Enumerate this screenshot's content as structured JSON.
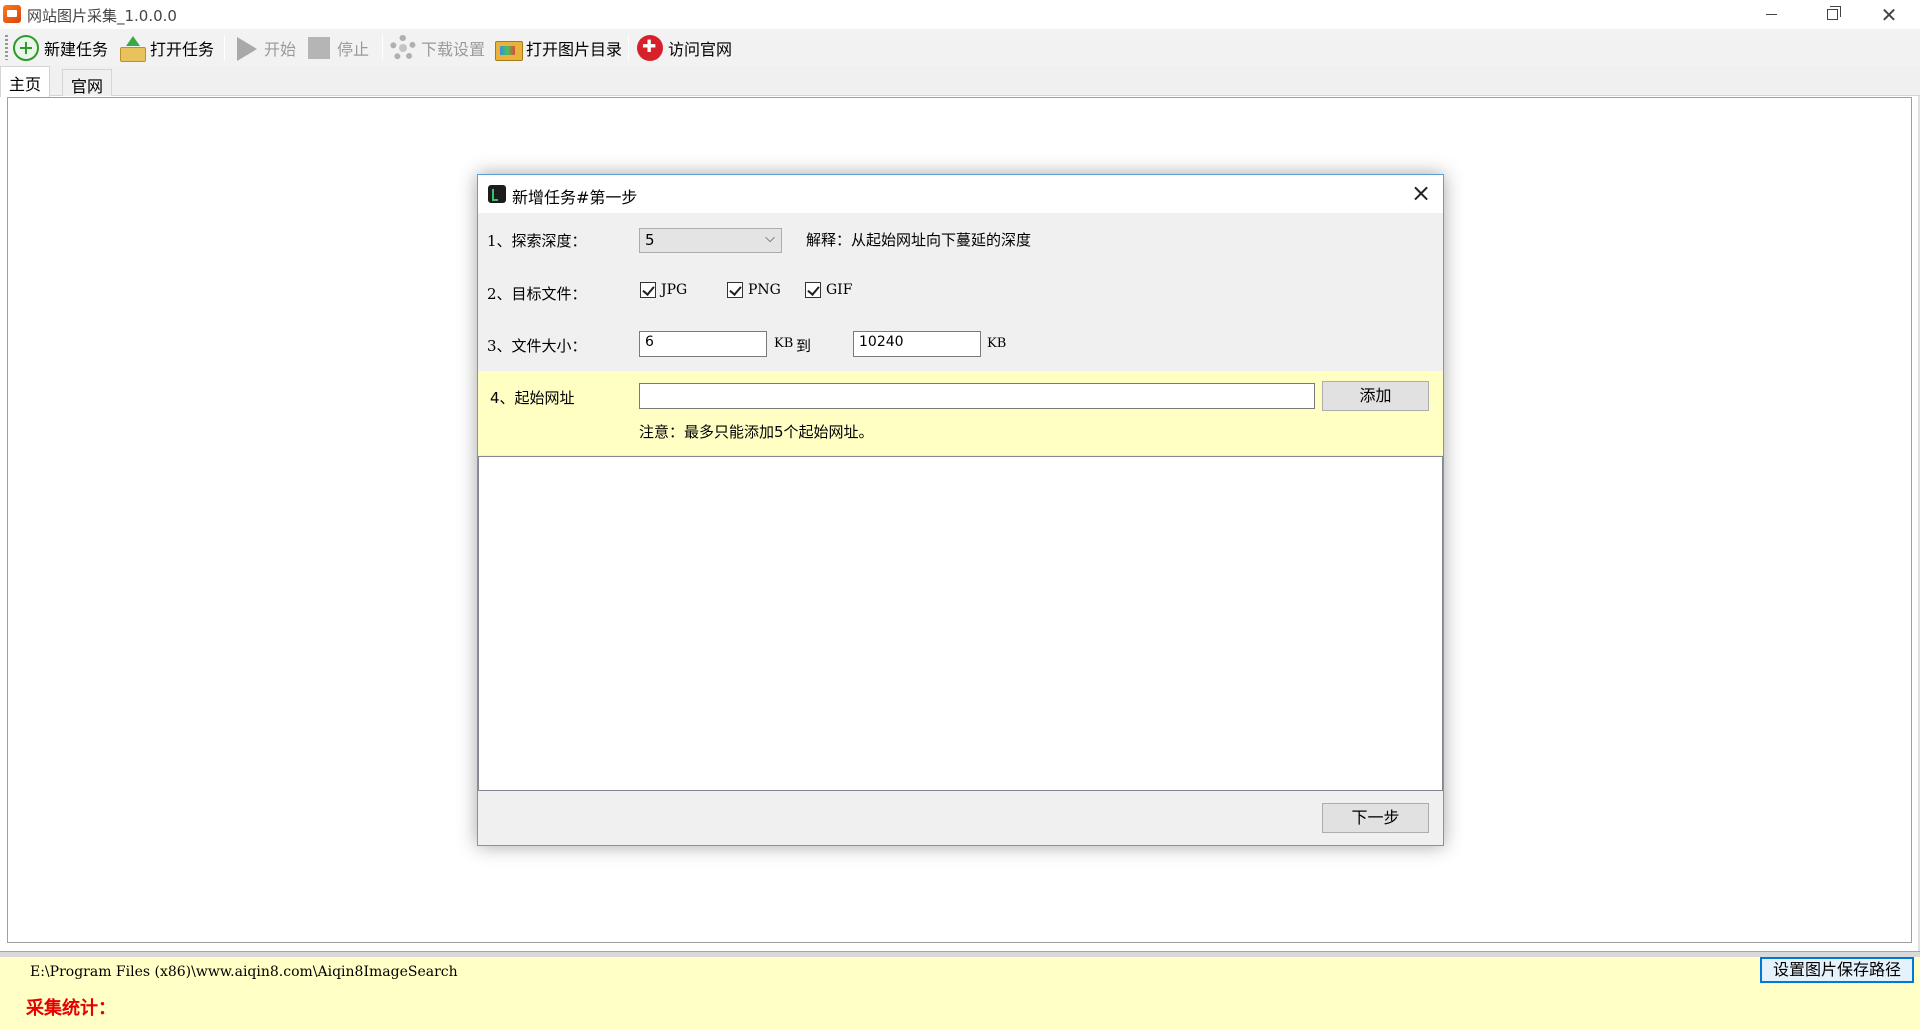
{
  "window": {
    "title": "网站图片采集_1.0.0.0"
  },
  "toolbar": {
    "new_task": "新建任务",
    "open_task": "打开任务",
    "start": "开始",
    "stop": "停止",
    "download_settings": "下载设置",
    "open_image_dir": "打开图片目录",
    "visit_site": "访问官网"
  },
  "tabs": [
    {
      "label": "主页",
      "active": true
    },
    {
      "label": "官网",
      "active": false
    }
  ],
  "dialog": {
    "title": "新增任务#第一步",
    "depth_label": "1、探索深度：",
    "depth_value": "5",
    "depth_hint": "解释：从起始网址向下蔓延的深度",
    "filetype_label": "2、目标文件：",
    "filetypes": [
      {
        "label": "JPG",
        "checked": true
      },
      {
        "label": "PNG",
        "checked": true
      },
      {
        "label": "GIF",
        "checked": true
      }
    ],
    "size_label": "3、文件大小：",
    "size_min": "6",
    "size_unit": "KB",
    "size_to": "到",
    "size_max": "10240",
    "url_label": "4、起始网址",
    "url_value": "",
    "add_button": "添加",
    "url_note": "注意：最多只能添加5个起始网址。",
    "next_button": "下一步"
  },
  "status": {
    "save_path": "E:\\Program Files (x86)\\www.aiqin8.com\\Aiqin8ImageSearch",
    "set_path_button": "设置图片保存路径",
    "stats_label": "采集统计："
  },
  "colors": {
    "note_panel": "#ffffc4",
    "stats_red": "#e60000",
    "dialog_border": "#5aa0d8"
  }
}
